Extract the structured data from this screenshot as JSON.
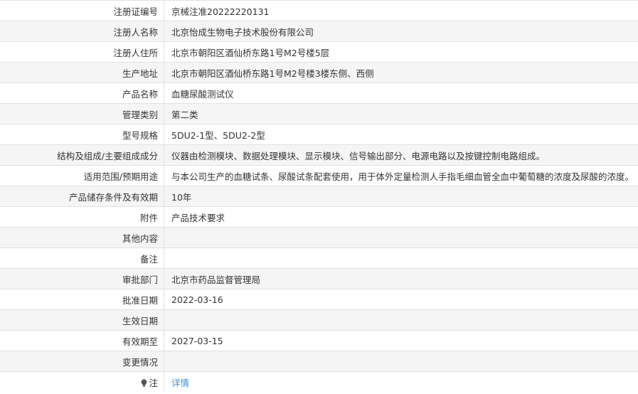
{
  "rows": [
    {
      "label": "注册证编号",
      "value": "京械注准20222220131"
    },
    {
      "label": "注册人名称",
      "value": "北京怡成生物电子技术股份有限公司"
    },
    {
      "label": "注册人住所",
      "value": "北京市朝阳区酒仙桥东路1号M2号楼5层"
    },
    {
      "label": "生产地址",
      "value": "北京市朝阳区酒仙桥东路1号M2号楼3楼东侧、西侧"
    },
    {
      "label": "产品名称",
      "value": "血糖尿酸测试仪"
    },
    {
      "label": "管理类别",
      "value": "第二类"
    },
    {
      "label": "型号规格",
      "value": "5DU2-1型、5DU2-2型"
    },
    {
      "label": "结构及组成/主要组成成分",
      "value": "仪器由检测模块、数据处理模块、显示模块、信号输出部分、电源电路以及按键控制电路组成。"
    },
    {
      "label": "适用范围/预期用途",
      "value": "与本公司生产的血糖试条、尿酸试条配套使用，用于体外定量检测人手指毛细血管全血中葡萄糖的浓度及尿酸的浓度。"
    },
    {
      "label": "产品储存条件及有效期",
      "value": "10年"
    },
    {
      "label": "附件",
      "value": "产品技术要求"
    },
    {
      "label": "其他内容",
      "value": ""
    },
    {
      "label": "备注",
      "value": ""
    },
    {
      "label": "审批部门",
      "value": "北京市药品监督管理局"
    },
    {
      "label": "批准日期",
      "value": "2022-03-16"
    },
    {
      "label": "生效日期",
      "value": ""
    },
    {
      "label": "有效期至",
      "value": "2027-03-15"
    },
    {
      "label": "变更情况",
      "value": ""
    }
  ],
  "note": {
    "icon": "lightbulb-icon",
    "label": "注",
    "link_text": "详情",
    "link_color": "#3a8fd6"
  },
  "colors": {
    "stripe": "#f5f5f5",
    "border": "#e1e1e1",
    "text": "#333333"
  }
}
